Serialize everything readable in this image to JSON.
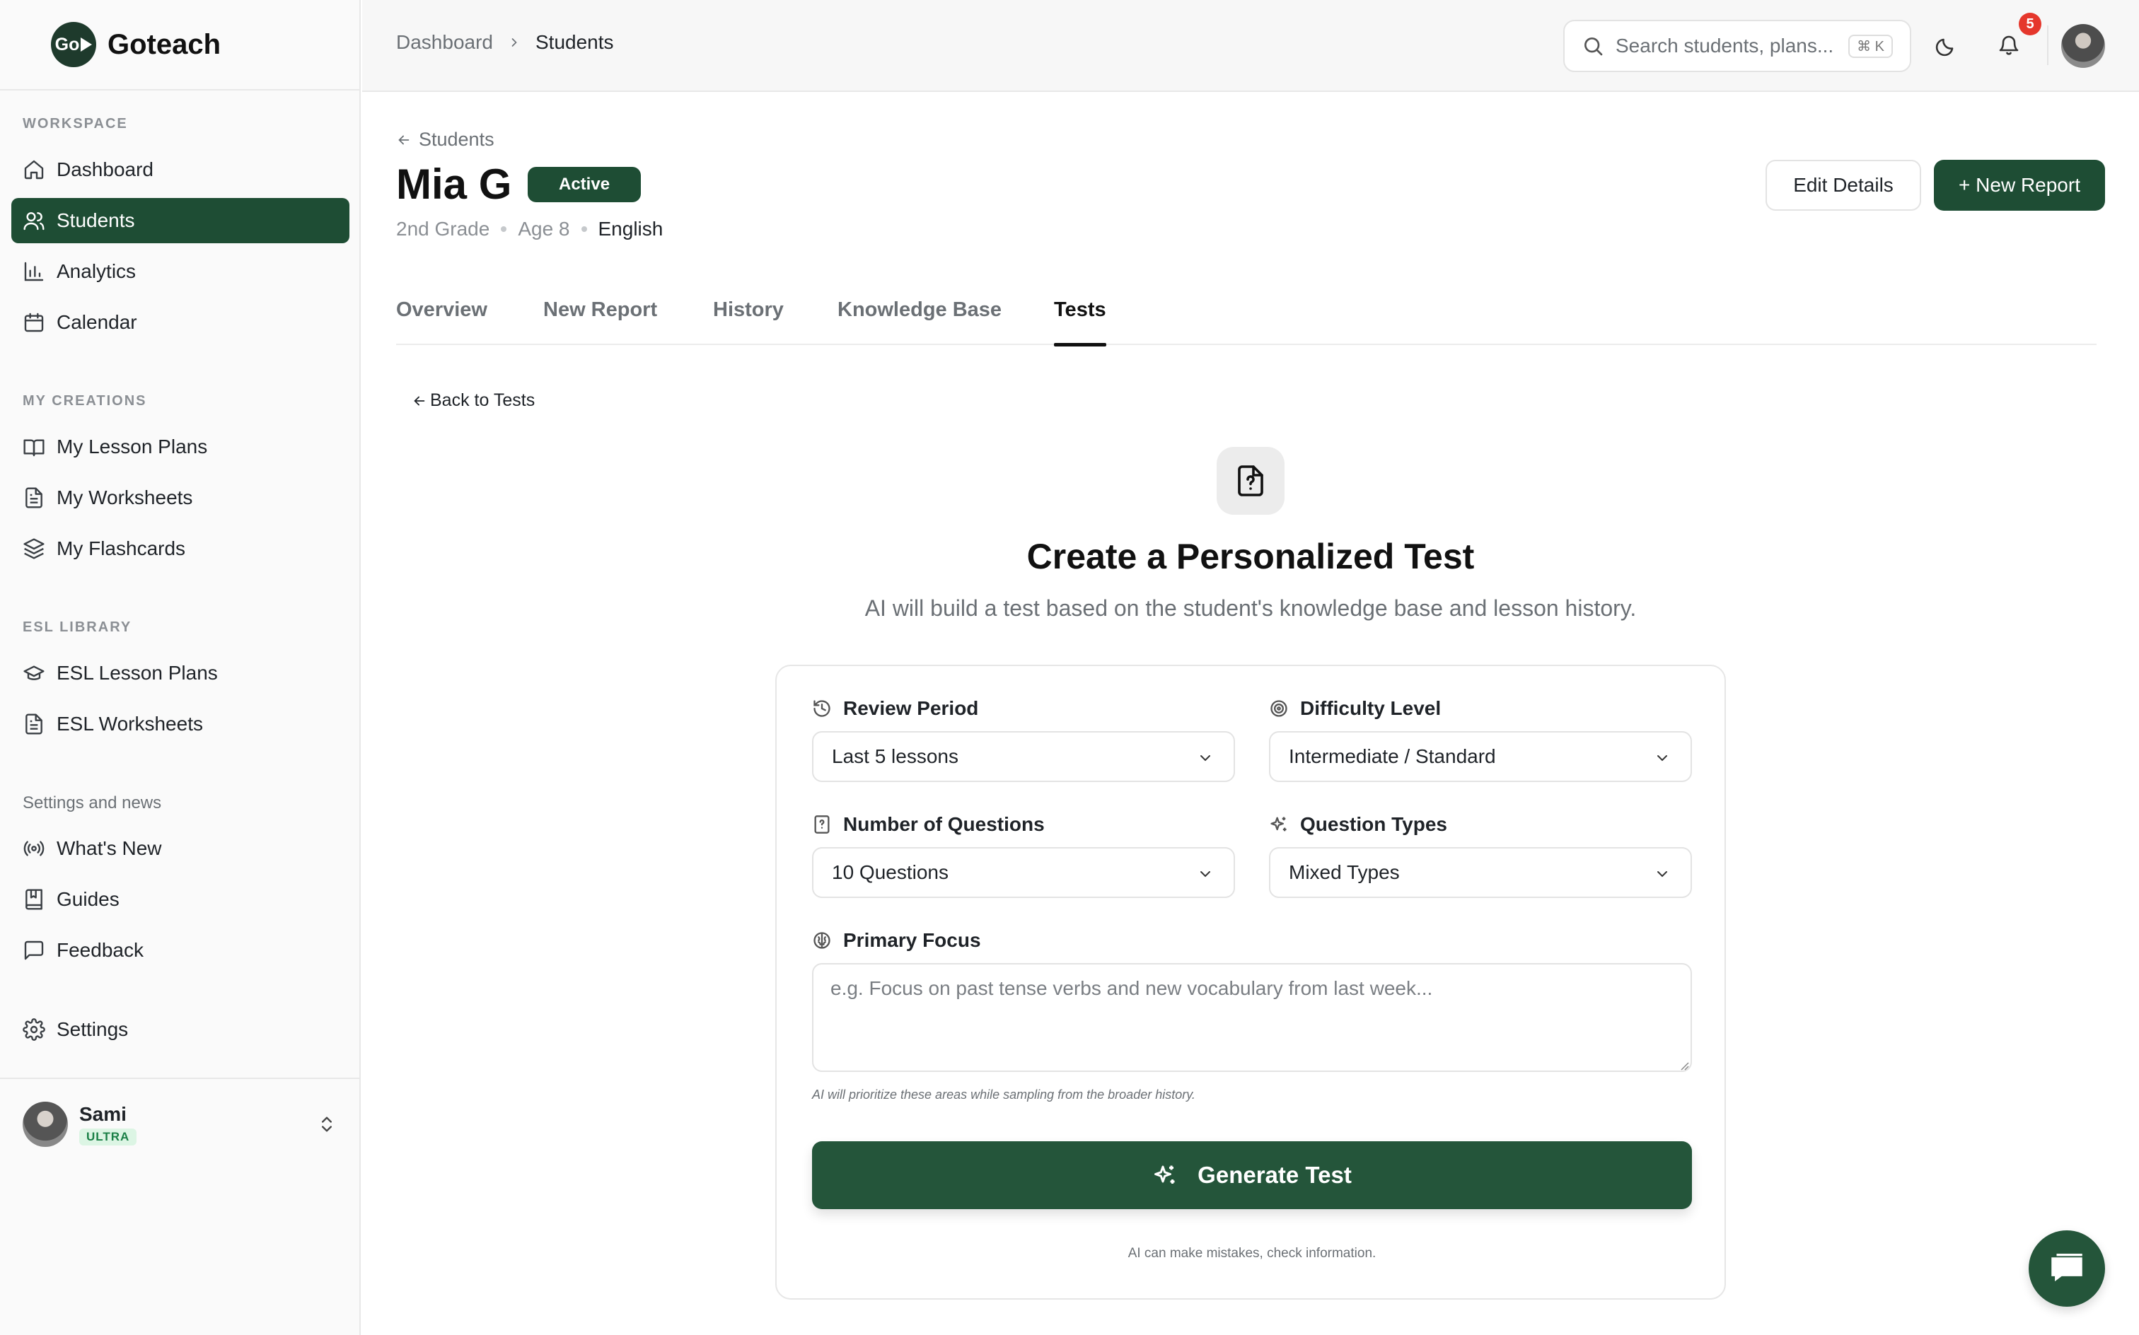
{
  "app": {
    "name": "Goteach",
    "logo_text": "Go"
  },
  "colors": {
    "brand": "#1e4d34",
    "notification": "#e5372c",
    "tier": "#1a7f46"
  },
  "sidebar": {
    "sections": [
      {
        "label": "WORKSPACE",
        "items": [
          {
            "label": "Dashboard",
            "icon": "home-icon"
          },
          {
            "label": "Students",
            "icon": "users-icon",
            "active": true
          },
          {
            "label": "Analytics",
            "icon": "bar-chart-icon"
          },
          {
            "label": "Calendar",
            "icon": "calendar-icon"
          }
        ]
      },
      {
        "label": "MY CREATIONS",
        "items": [
          {
            "label": "My Lesson Plans",
            "icon": "book-open-icon"
          },
          {
            "label": "My Worksheets",
            "icon": "file-text-icon"
          },
          {
            "label": "My Flashcards",
            "icon": "layers-icon"
          }
        ]
      },
      {
        "label": "ESL LIBRARY",
        "items": [
          {
            "label": "ESL Lesson Plans",
            "icon": "graduation-cap-icon"
          },
          {
            "label": "ESL Worksheets",
            "icon": "file-text-icon"
          }
        ]
      },
      {
        "label": "Settings and news",
        "items": [
          {
            "label": "What's New",
            "icon": "radio-icon"
          },
          {
            "label": "Guides",
            "icon": "book-icon"
          },
          {
            "label": "Feedback",
            "icon": "message-square-icon"
          }
        ]
      }
    ],
    "settings_label": "Settings",
    "user": {
      "name": "Sami",
      "tier": "ULTRA"
    }
  },
  "header": {
    "breadcrumb": [
      "Dashboard",
      "Students"
    ],
    "search": {
      "placeholder": "Search students, plans...",
      "shortcut": "⌘ K"
    },
    "notification_count": "5"
  },
  "student": {
    "back_label": "Students",
    "name": "Mia G",
    "status": "Active",
    "grade": "2nd Grade",
    "age": "Age 8",
    "language": "English",
    "edit_label": "Edit Details",
    "new_report_label": "+ New Report"
  },
  "tabs": [
    {
      "label": "Overview"
    },
    {
      "label": "New Report"
    },
    {
      "label": "History"
    },
    {
      "label": "Knowledge Base"
    },
    {
      "label": "Tests",
      "active": true
    }
  ],
  "test_form": {
    "back_label": "Back to Tests",
    "title": "Create a Personalized Test",
    "subtitle": "AI will build a test based on the student's knowledge base and lesson history.",
    "review_period": {
      "label": "Review Period",
      "value": "Last 5 lessons"
    },
    "difficulty": {
      "label": "Difficulty Level",
      "value": "Intermediate / Standard"
    },
    "num_questions": {
      "label": "Number of Questions",
      "value": "10 Questions"
    },
    "question_types": {
      "label": "Question Types",
      "value": "Mixed Types"
    },
    "primary_focus": {
      "label": "Primary Focus",
      "placeholder": "e.g. Focus on past tense verbs and new vocabulary from last week...",
      "hint": "AI will prioritize these areas while sampling from the broader history."
    },
    "generate_label": "Generate Test",
    "disclaimer": "AI can make mistakes, check information."
  }
}
